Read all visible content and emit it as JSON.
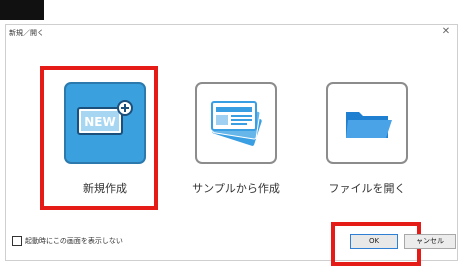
{
  "dialog": {
    "title": "新規／開く",
    "close_glyph": "✕"
  },
  "options": [
    {
      "label": "新規作成",
      "icon": "new-document-icon",
      "selected": true
    },
    {
      "label": "サンプルから作成",
      "icon": "sample-cards-icon",
      "selected": false
    },
    {
      "label": "ファイルを開く",
      "icon": "folder-icon",
      "selected": false
    }
  ],
  "icon_text": {
    "new_badge": "NEW"
  },
  "footer": {
    "checkbox_label": "起動時にこの画面を表示しない",
    "checkbox_checked": false
  },
  "buttons": {
    "ok_label": "OK",
    "cancel_label": "ャンセル"
  },
  "colors": {
    "highlight": "#e41b17",
    "selected_tile": "#3aa0de",
    "icon_blue": "#1f7fd1",
    "ok_border": "#2f7fd4"
  }
}
